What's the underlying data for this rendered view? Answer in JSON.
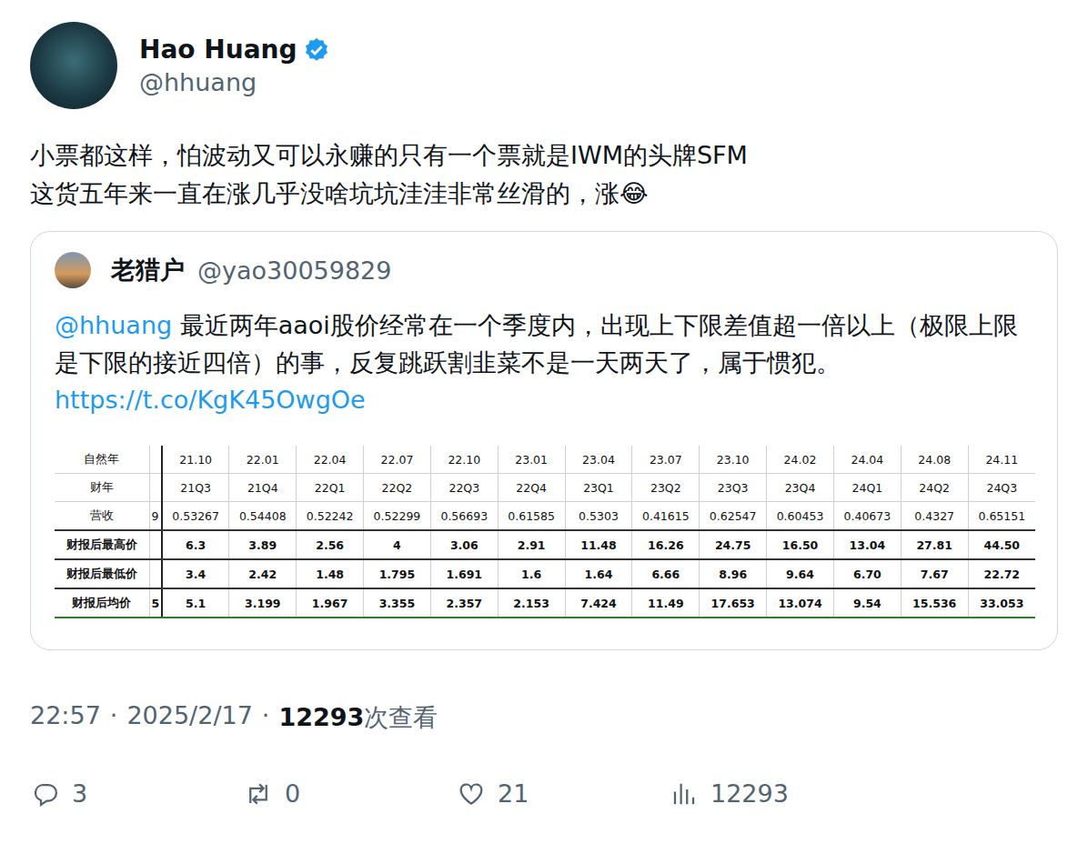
{
  "author": {
    "name": "Hao Huang",
    "handle": "@hhuang",
    "verified": true
  },
  "tweet": {
    "lines": [
      "小票都这样，怕波动又可以永赚的只有一个票就是IWM的头牌SFM",
      "这货五年来一直在涨几乎没啥坑坑洼洼非常丝滑的，涨😂"
    ]
  },
  "quote": {
    "author": {
      "name": "老猎户",
      "handle": "@yao30059829"
    },
    "text_parts": [
      {
        "text": "@hhuang",
        "kind": "mention"
      },
      {
        "text": " 最近两年aaoi股价经常在一个季度内，出现上下限差值超一倍以上（极限上限是下限的接近四倍）的事，反复跳跃割韭菜不是一天两天了，属于惯犯。 ",
        "kind": "plain"
      },
      {
        "text": "https://t.co/KgK45OwgOe",
        "kind": "link"
      }
    ],
    "table": {
      "rows": [
        {
          "label": "自然年",
          "cut": "",
          "emphasis": false,
          "cells": [
            "21.10",
            "22.01",
            "22.04",
            "22.07",
            "22.10",
            "23.01",
            "23.04",
            "23.07",
            "23.10",
            "24.02",
            "24.04",
            "24.08",
            "24.11"
          ]
        },
        {
          "label": "财年",
          "cut": "",
          "emphasis": false,
          "cells": [
            "21Q3",
            "21Q4",
            "22Q1",
            "22Q2",
            "22Q3",
            "22Q4",
            "23Q1",
            "23Q2",
            "23Q3",
            "23Q4",
            "24Q1",
            "24Q2",
            "24Q3"
          ]
        },
        {
          "label": "营收",
          "cut": "9",
          "emphasis": false,
          "cells": [
            "0.53267",
            "0.54408",
            "0.52242",
            "0.52299",
            "0.56693",
            "0.61585",
            "0.5303",
            "0.41615",
            "0.62547",
            "0.60453",
            "0.40673",
            "0.4327",
            "0.65151"
          ]
        },
        {
          "label": "财报后最高价",
          "cut": "",
          "emphasis": true,
          "cells": [
            "6.3",
            "3.89",
            "2.56",
            "4",
            "3.06",
            "2.91",
            "11.48",
            "16.26",
            "24.75",
            "16.50",
            "13.04",
            "27.81",
            "44.50"
          ]
        },
        {
          "label": "财报后最低价",
          "cut": "",
          "emphasis": true,
          "cells": [
            "3.4",
            "2.42",
            "1.48",
            "1.795",
            "1.691",
            "1.6",
            "1.64",
            "6.66",
            "8.96",
            "9.64",
            "6.70",
            "7.67",
            "22.72"
          ]
        },
        {
          "label": "财报后均价",
          "cut": "5",
          "emphasis": true,
          "cells": [
            "5.1",
            "3.199",
            "1.967",
            "3.355",
            "2.357",
            "2.153",
            "7.424",
            "11.49",
            "17.653",
            "13.074",
            "9.54",
            "15.536",
            "33.053"
          ]
        }
      ]
    }
  },
  "meta": {
    "time": "22:57",
    "separator": "·",
    "date": "2025/2/17",
    "views": "12293",
    "views_label": "次查看"
  },
  "actions": [
    {
      "name": "reply",
      "count": "3"
    },
    {
      "name": "retweet",
      "count": "0"
    },
    {
      "name": "like",
      "count": "21"
    },
    {
      "name": "views",
      "count": "12293"
    }
  ]
}
